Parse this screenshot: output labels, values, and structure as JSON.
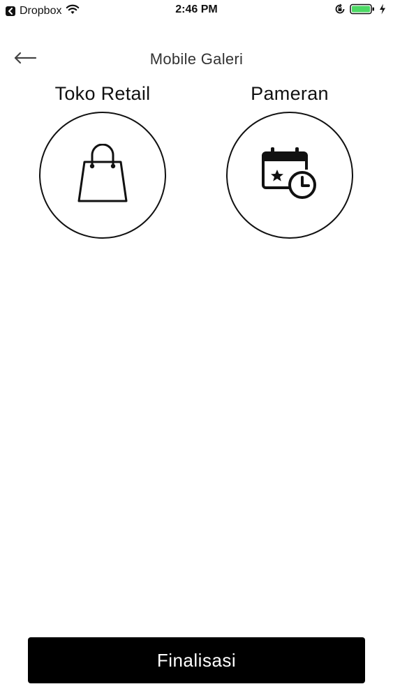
{
  "status_bar": {
    "back_app": "Dropbox",
    "time": "2:46 PM",
    "colors": {
      "battery": "#4cd964"
    }
  },
  "header": {
    "title": "Mobile Galeri",
    "back_icon": "arrow-left-icon"
  },
  "options": [
    {
      "label": "Toko Retail",
      "icon": "shopping-bag-icon"
    },
    {
      "label": "Pameran",
      "icon": "calendar-clock-icon"
    }
  ],
  "footer": {
    "finalize_label": "Finalisasi",
    "colors": {
      "button_bg": "#000000",
      "button_text": "#ffffff"
    }
  }
}
